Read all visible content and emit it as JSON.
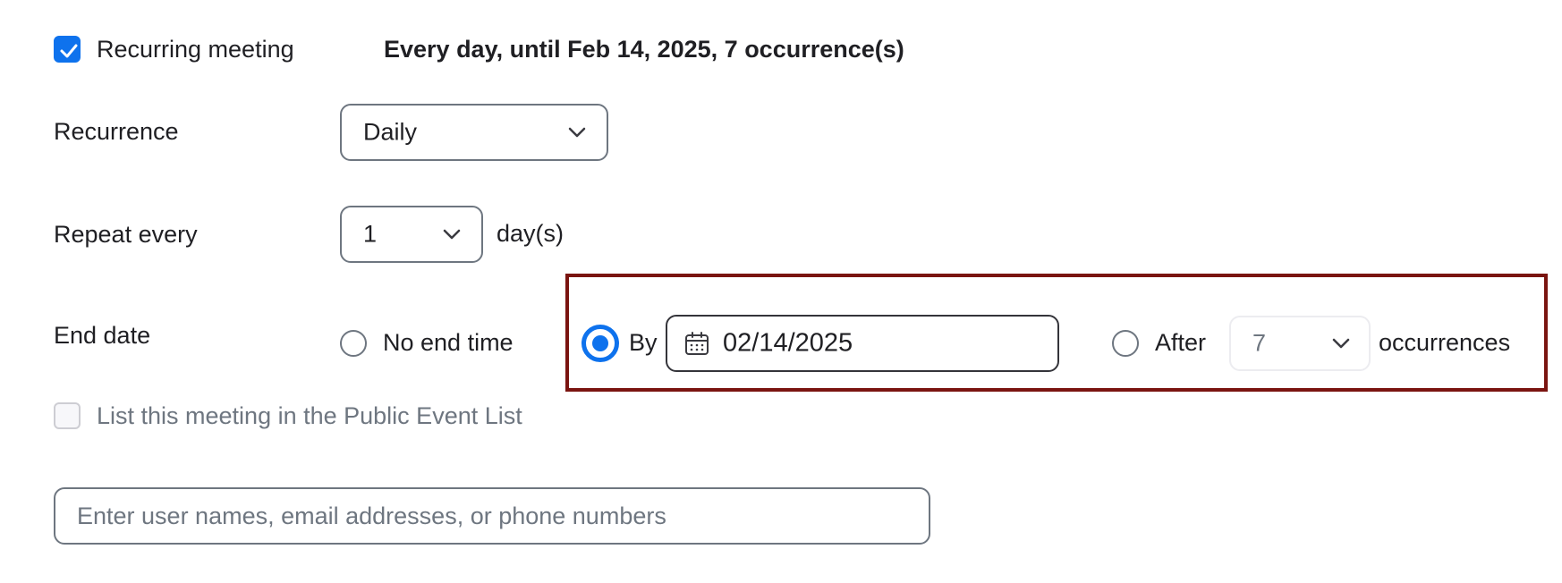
{
  "recurring": {
    "label": "Recurring meeting",
    "checked": true,
    "summary": "Every day, until Feb 14, 2025, 7 occurrence(s)"
  },
  "recurrence": {
    "label": "Recurrence",
    "value": "Daily"
  },
  "repeat": {
    "label": "Repeat every",
    "value": "1",
    "unit": "day(s)"
  },
  "end_date": {
    "label": "End date",
    "no_end_label": "No end time",
    "by_label": "By",
    "by_value": "02/14/2025",
    "after_label": "After",
    "after_value": "7",
    "occurrences_label": "occurrences",
    "selected": "by"
  },
  "public_list": {
    "label": "List this meeting in the Public Event List",
    "checked": false
  },
  "invitees": {
    "placeholder": "Enter user names, email addresses, or phone numbers",
    "value": ""
  },
  "icons": {
    "check": "check-icon",
    "chevron": "chevron-down-icon",
    "calendar": "calendar-icon"
  },
  "colors": {
    "accent": "#0e72ed",
    "highlight": "#7a1410",
    "text": "#1f1f23",
    "muted": "#6e7680"
  }
}
